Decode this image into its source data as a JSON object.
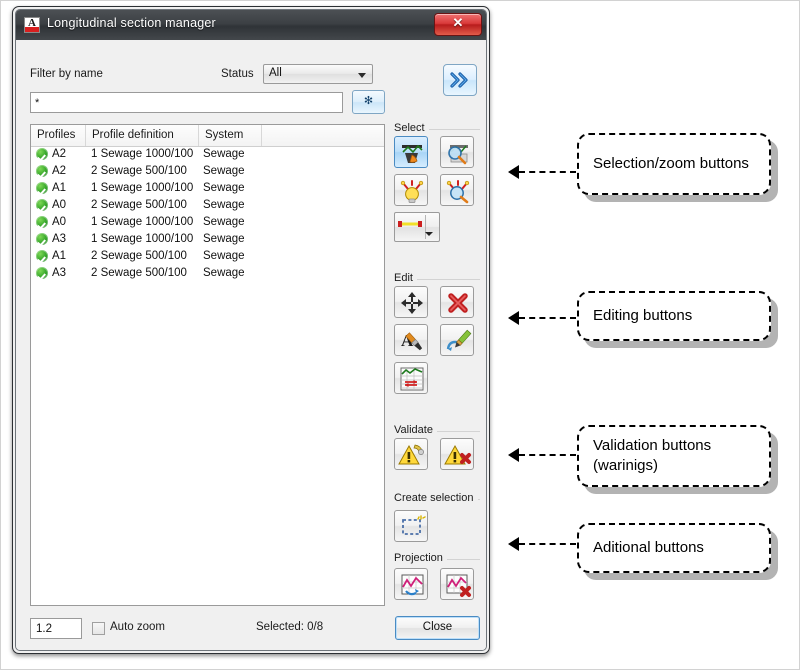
{
  "window": {
    "title": "Longitudinal section manager",
    "app_icon": "autocad-a-icon",
    "close_glyph": "✕"
  },
  "filter": {
    "filter_label": "Filter by name",
    "status_label": "Status",
    "status_value": "All",
    "status_options": [
      "All"
    ],
    "filter_value": "*",
    "filter_placeholder": "*",
    "star_button_glyph": "✻",
    "expand_button_glyph": "»"
  },
  "table": {
    "columns": [
      "Profiles",
      "Profile definition",
      "System",
      ""
    ],
    "rows": [
      {
        "status": "ok",
        "profile": "A2",
        "definition": "1 Sewage  1000/100",
        "system": "Sewage"
      },
      {
        "status": "ok",
        "profile": "A2",
        "definition": "2 Sewage  500/100",
        "system": "Sewage"
      },
      {
        "status": "ok",
        "profile": "A1",
        "definition": "1 Sewage  1000/100",
        "system": "Sewage"
      },
      {
        "status": "ok",
        "profile": "A0",
        "definition": "2 Sewage  500/100",
        "system": "Sewage"
      },
      {
        "status": "ok",
        "profile": "A0",
        "definition": "1 Sewage  1000/100",
        "system": "Sewage"
      },
      {
        "status": "ok",
        "profile": "A3",
        "definition": "1 Sewage  1000/100",
        "system": "Sewage"
      },
      {
        "status": "ok",
        "profile": "A1",
        "definition": "2 Sewage  500/100",
        "system": "Sewage"
      },
      {
        "status": "ok",
        "profile": "A3",
        "definition": "2 Sewage  500/100",
        "system": "Sewage"
      }
    ]
  },
  "groups": {
    "select": {
      "title": "Select",
      "buttons": [
        {
          "name": "select-profile-in-drawing-button",
          "icon": "cursor-pick-profile-icon",
          "active": true
        },
        {
          "name": "zoom-to-profile-button",
          "icon": "magnifier-profile-icon",
          "active": false
        },
        {
          "name": "highlight-profile-button",
          "icon": "lightbulb-highlight-icon",
          "active": false
        },
        {
          "name": "zoom-highlight-button",
          "icon": "magnifier-highlight-icon",
          "active": false
        }
      ],
      "split_button": {
        "name": "line-style-split-button",
        "icon": "yellow-line-icon"
      }
    },
    "edit": {
      "title": "Edit",
      "buttons": [
        {
          "name": "move-profile-button",
          "icon": "move-arrows-icon"
        },
        {
          "name": "delete-profile-button",
          "icon": "red-cross-icon"
        },
        {
          "name": "edit-labels-button",
          "icon": "letter-a-brush-icon"
        },
        {
          "name": "edit-properties-button",
          "icon": "pencil-edit-icon"
        },
        {
          "name": "swap-profile-data-button",
          "icon": "chart-swap-icon"
        }
      ]
    },
    "validate": {
      "title": "Validate",
      "buttons": [
        {
          "name": "validate-profile-button",
          "icon": "warning-check-icon"
        },
        {
          "name": "clear-warnings-button",
          "icon": "warning-delete-icon"
        }
      ]
    },
    "create_selection": {
      "title": "Create selection",
      "buttons": [
        {
          "name": "create-selection-set-button",
          "icon": "dashed-rectangle-icon"
        }
      ]
    },
    "projection": {
      "title": "Projection",
      "buttons": [
        {
          "name": "add-projection-button",
          "icon": "chart-projection-icon"
        },
        {
          "name": "delete-projection-button",
          "icon": "chart-projection-delete-icon"
        }
      ]
    }
  },
  "footer": {
    "zoom_value": "1.2",
    "auto_zoom_label": "Auto zoom",
    "auto_zoom_checked": false,
    "selected_status": "Selected: 0/8",
    "close_label": "Close"
  },
  "annotations": [
    {
      "name": "callout-selection-zoom",
      "text": "Selection/zoom buttons"
    },
    {
      "name": "callout-editing",
      "text": "Editing buttons"
    },
    {
      "name": "callout-validation",
      "text": "Validation    buttons (warinigs)"
    },
    {
      "name": "callout-additional",
      "text": "Aditional buttons"
    }
  ]
}
